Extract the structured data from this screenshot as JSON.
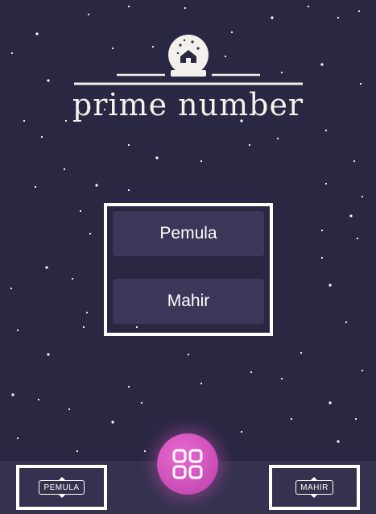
{
  "app": {
    "title": "prime number"
  },
  "menu": {
    "options": [
      {
        "label": "Pemula"
      },
      {
        "label": "Mahir"
      }
    ]
  },
  "bottom_bar": {
    "left_tag": "PEMULA",
    "right_tag": "MAHIR",
    "center_button_icon": "grid-icon"
  },
  "colors": {
    "background": "#2a2743",
    "button": "#3a3758",
    "bottom_bar": "#35324f",
    "fab": "#c94bb5",
    "frame": "#ffffff"
  },
  "icons": [
    "snow-globe-icon",
    "grid-icon"
  ]
}
